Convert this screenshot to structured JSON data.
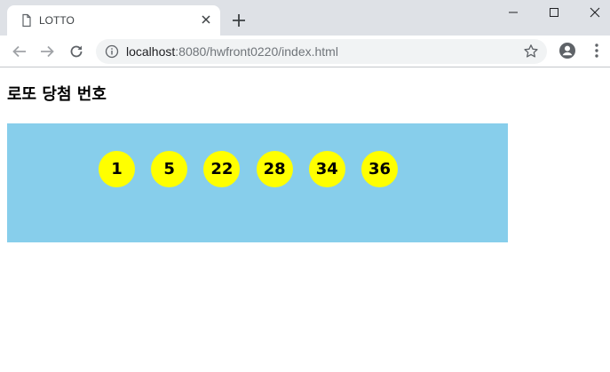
{
  "browser": {
    "tab": {
      "title": "LOTTO",
      "page_icon": "page-icon",
      "close_icon": "close-icon"
    },
    "new_tab_icon": "plus-icon",
    "window_controls": {
      "minimize": "minimize-icon",
      "maximize": "maximize-icon",
      "close": "close-icon"
    },
    "nav": {
      "back": "back-arrow-icon",
      "forward": "forward-arrow-icon",
      "reload": "reload-icon"
    },
    "address": {
      "host": "localhost",
      "rest": ":8080/hwfront0220/index.html",
      "info_icon": "info-icon",
      "bookmark_icon": "star-icon"
    },
    "account_icon": "account-icon",
    "menu_icon": "kebab-menu-icon"
  },
  "page": {
    "heading": "로또 당첨 번호",
    "lotto": {
      "background_color": "#87ceeb",
      "ball_color": "#ffff00",
      "numbers": [
        "1",
        "5",
        "22",
        "28",
        "34",
        "36"
      ]
    }
  }
}
